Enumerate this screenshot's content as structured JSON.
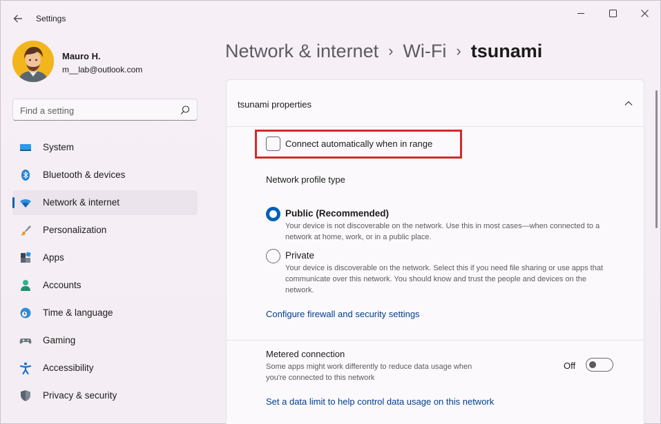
{
  "app": {
    "title": "Settings"
  },
  "user": {
    "name": "Mauro H.",
    "email": "m__lab@outlook.com"
  },
  "search": {
    "placeholder": "Find a setting"
  },
  "sidebar": {
    "items": [
      {
        "label": "System",
        "icon": "monitor-icon"
      },
      {
        "label": "Bluetooth & devices",
        "icon": "bluetooth-icon"
      },
      {
        "label": "Network & internet",
        "icon": "wifi-icon",
        "active": true
      },
      {
        "label": "Personalization",
        "icon": "brush-icon"
      },
      {
        "label": "Apps",
        "icon": "apps-icon"
      },
      {
        "label": "Accounts",
        "icon": "person-icon"
      },
      {
        "label": "Time & language",
        "icon": "clock-globe-icon"
      },
      {
        "label": "Gaming",
        "icon": "gamepad-icon"
      },
      {
        "label": "Accessibility",
        "icon": "accessibility-icon"
      },
      {
        "label": "Privacy & security",
        "icon": "shield-icon"
      }
    ]
  },
  "breadcrumb": {
    "items": [
      "Network & internet",
      "Wi-Fi"
    ],
    "separator": "›",
    "current": "tsunami"
  },
  "properties": {
    "title": "tsunami properties",
    "auto_connect": {
      "label": "Connect automatically when in range",
      "checked": false
    },
    "profile_type": {
      "label": "Network profile type",
      "options": [
        {
          "title": "Public (Recommended)",
          "description": "Your device is not discoverable on the network. Use this in most cases—when connected to a network at home, work, or in a public place.",
          "selected": true
        },
        {
          "title": "Private",
          "description": "Your device is discoverable on the network. Select this if you need file sharing or use apps that communicate over this network. You should know and trust the people and devices on the network.",
          "selected": false
        }
      ]
    },
    "firewall_link": "Configure firewall and security settings",
    "metered": {
      "title": "Metered connection",
      "description": "Some apps might work differently to reduce data usage when you're connected to this network",
      "state_label": "Off",
      "on": false
    },
    "data_limit_link": "Set a data limit to help control data usage on this network"
  },
  "colors": {
    "accent": "#005fb8",
    "highlight": "#d22a2a",
    "link": "#003e92"
  }
}
